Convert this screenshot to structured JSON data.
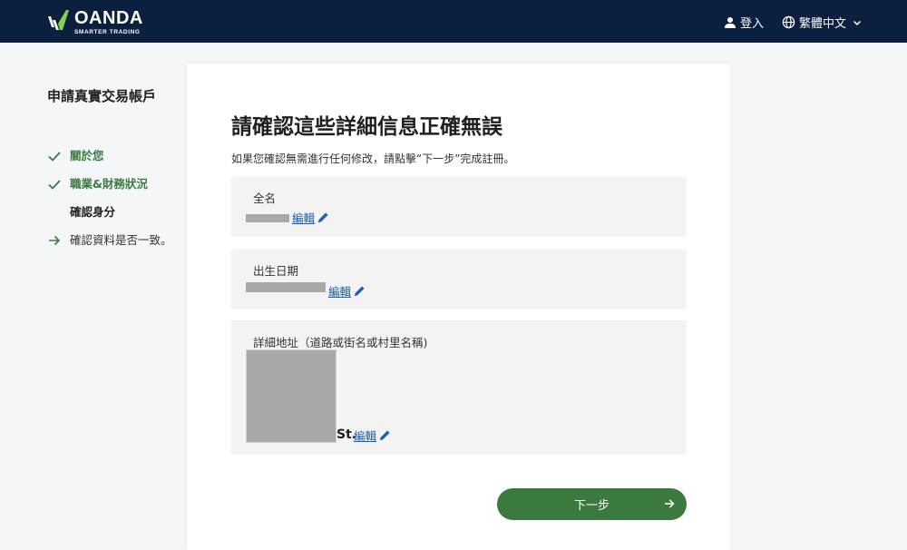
{
  "header": {
    "brand_name": "OANDA",
    "brand_tagline": "SMARTER TRADING",
    "login_label": "登入",
    "language_label": "繁體中文"
  },
  "sidebar": {
    "title": "申請真實交易帳戶",
    "steps": [
      {
        "label": "關於您",
        "state": "done"
      },
      {
        "label": "職業&財務狀況",
        "state": "done"
      },
      {
        "label": "確認身分",
        "state": "current"
      },
      {
        "label": "確認資料是否一致。",
        "state": "next"
      }
    ]
  },
  "main": {
    "heading": "請確認這些詳細信息正確無誤",
    "intro": "如果您確認無需進行任何修改，請點擊“下一步”完成註冊。",
    "fields": [
      {
        "label": "全名",
        "edit_label": "編輯"
      },
      {
        "label": "出生日期",
        "edit_label": "編輯"
      },
      {
        "label": "詳細地址（道路或街名或村里名稱)",
        "value_suffix": "St.",
        "edit_label": "編輯"
      }
    ],
    "next_button": "下一步"
  },
  "colors": {
    "header_bg": "#0b1f3f",
    "accent_green": "#3b7a3e",
    "link_blue": "#1a5fb4",
    "page_bg": "#f4f6f9"
  },
  "icons": {
    "logo": "oanda-logo-icon",
    "login": "user-icon",
    "language": "globe-icon",
    "dropdown": "chevron-down-icon",
    "step_done": "check-icon",
    "step_next": "arrow-right-icon",
    "edit": "pencil-icon"
  }
}
